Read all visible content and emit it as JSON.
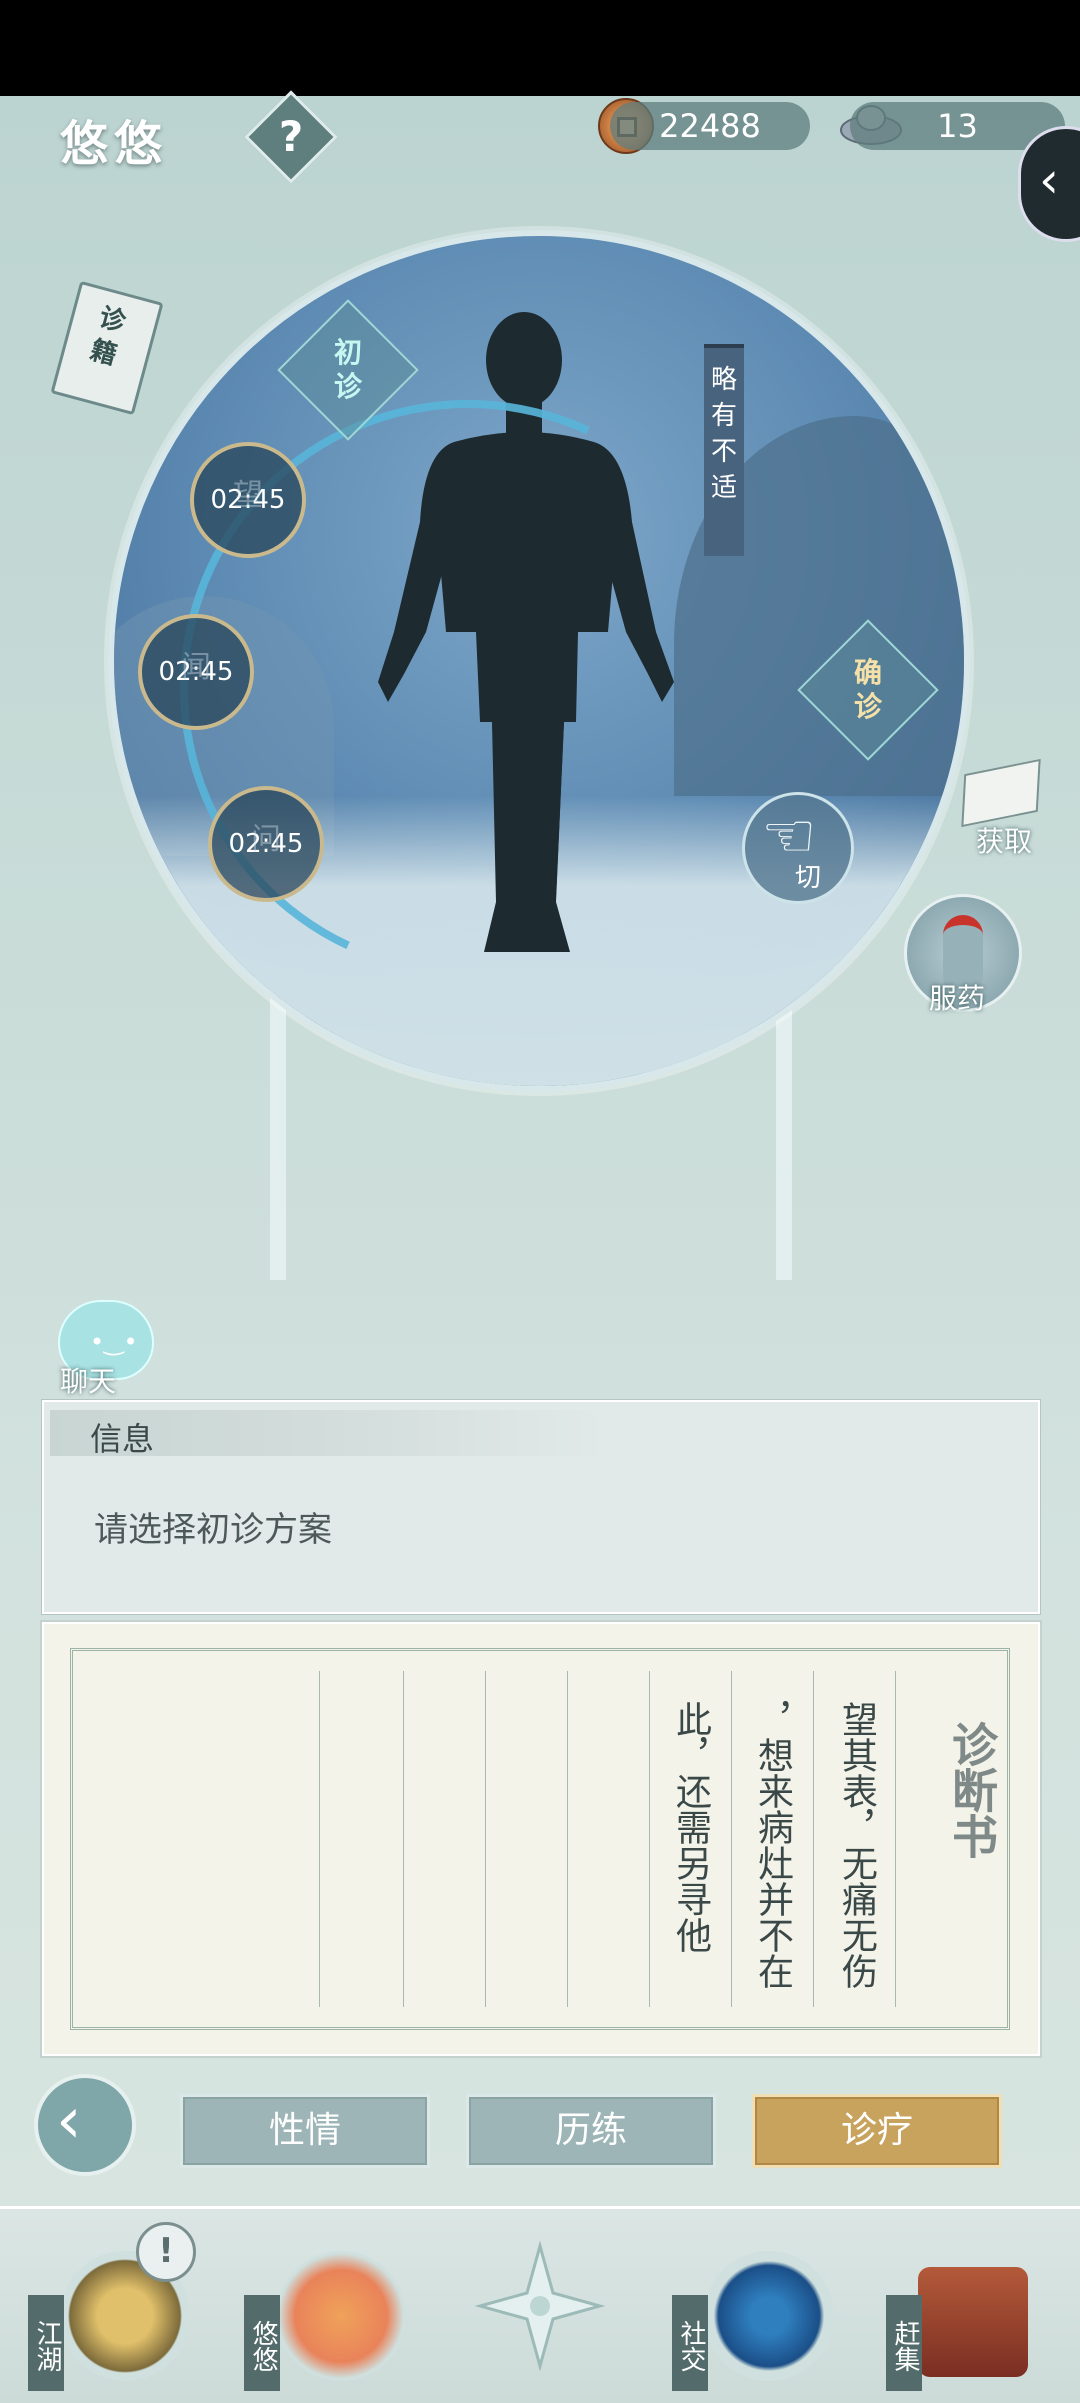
{
  "header": {
    "character_name": "悠悠",
    "help_label": "?",
    "coins": "22488",
    "silver": "13"
  },
  "book_label": "诊籍",
  "body_view": {
    "status_banner": "略有不适",
    "first_diagnosis": "初诊",
    "confirm_diagnosis": "确诊",
    "timers": [
      {
        "time": "02:45",
        "method": "望"
      },
      {
        "time": "02:45",
        "method": "闻"
      },
      {
        "time": "02:45",
        "method": "问"
      }
    ],
    "pulse_button": "切"
  },
  "side_actions": {
    "get_label": "获取",
    "medicine_label": "服药"
  },
  "chat": {
    "label": "聊天"
  },
  "info": {
    "title": "信息",
    "message": "请选择初诊方案"
  },
  "diagnosis_book": {
    "title": "诊断书",
    "lines": [
      "望其表，无痛无伤",
      "，想来病灶并不在",
      "此，还需另寻他"
    ]
  },
  "tabs": [
    {
      "label": "性情",
      "active": false
    },
    {
      "label": "历练",
      "active": false
    },
    {
      "label": "诊疗",
      "active": true
    }
  ],
  "bottom_nav": [
    {
      "label": "江湖"
    },
    {
      "label": "悠悠"
    },
    {
      "label": ""
    },
    {
      "label": "社交"
    },
    {
      "label": "赶集"
    }
  ],
  "colors": {
    "active_tab": "#c8a35d",
    "tab": "#9db5b6",
    "panel_bg": "#e1eae8"
  }
}
